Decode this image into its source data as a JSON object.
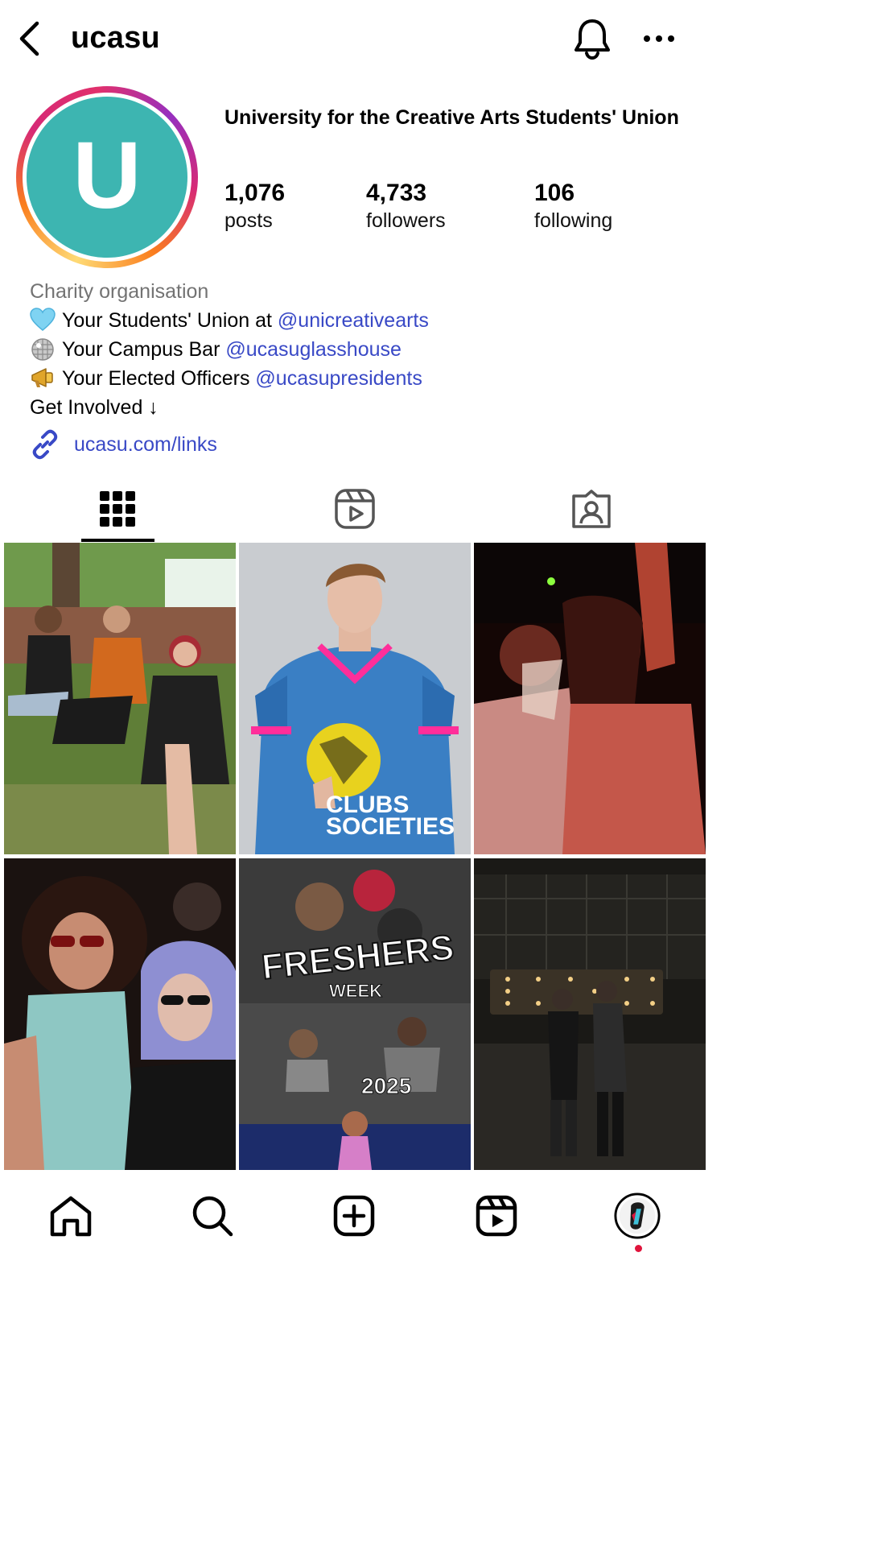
{
  "header": {
    "username": "ucasu",
    "icons": {
      "back": "chevron-left-icon",
      "notifications": "bell-icon",
      "more": "more-horizontal-icon"
    }
  },
  "profile": {
    "avatar_letter": "U",
    "avatar_color": "#3db5b1",
    "full_name": "University for the Creative Arts Students' Union",
    "stats": [
      {
        "value": "1,076",
        "label": "posts"
      },
      {
        "value": "4,733",
        "label": "followers"
      },
      {
        "value": "106",
        "label": "following"
      }
    ]
  },
  "bio": {
    "category": "Charity organisation",
    "lines": [
      {
        "emoji": "light-blue-heart",
        "text": "Your Students' Union at ",
        "mention": "@unicreativearts"
      },
      {
        "emoji": "disco-ball",
        "text": "Your Campus Bar ",
        "mention": "@ucasuglasshouse"
      },
      {
        "emoji": "megaphone",
        "text": "Your Elected Officers ",
        "mention": "@ucasupresidents"
      }
    ],
    "cta": "Get Involved ↓",
    "link": "ucasu.com/links"
  },
  "tabs": [
    {
      "name": "posts-grid",
      "icon": "grid-icon",
      "active": true
    },
    {
      "name": "reels",
      "icon": "reels-icon",
      "active": false
    },
    {
      "name": "tagged",
      "icon": "tagged-user-icon",
      "active": false
    }
  ],
  "posts": [
    {
      "overlay": ""
    },
    {
      "overlay": "CLUBS & SOCIETIES"
    },
    {
      "overlay": ""
    },
    {
      "overlay": ""
    },
    {
      "overlay": "FRESHERS WEEK 2025"
    },
    {
      "overlay": ""
    }
  ],
  "post_overlays": {
    "clubs_line1": "CLUBS",
    "clubs_line2": "SOCIETIES",
    "freshers": "FRESHERS",
    "week": "WEEK",
    "year": "2025"
  },
  "bottom_nav": [
    {
      "name": "home",
      "icon": "home-icon"
    },
    {
      "name": "search",
      "icon": "search-icon"
    },
    {
      "name": "create",
      "icon": "plus-square-icon"
    },
    {
      "name": "reels",
      "icon": "reels-icon"
    },
    {
      "name": "profile",
      "icon": "profile-avatar"
    }
  ],
  "colors": {
    "link": "#3949c6",
    "accent_dot": "#e0143c"
  }
}
